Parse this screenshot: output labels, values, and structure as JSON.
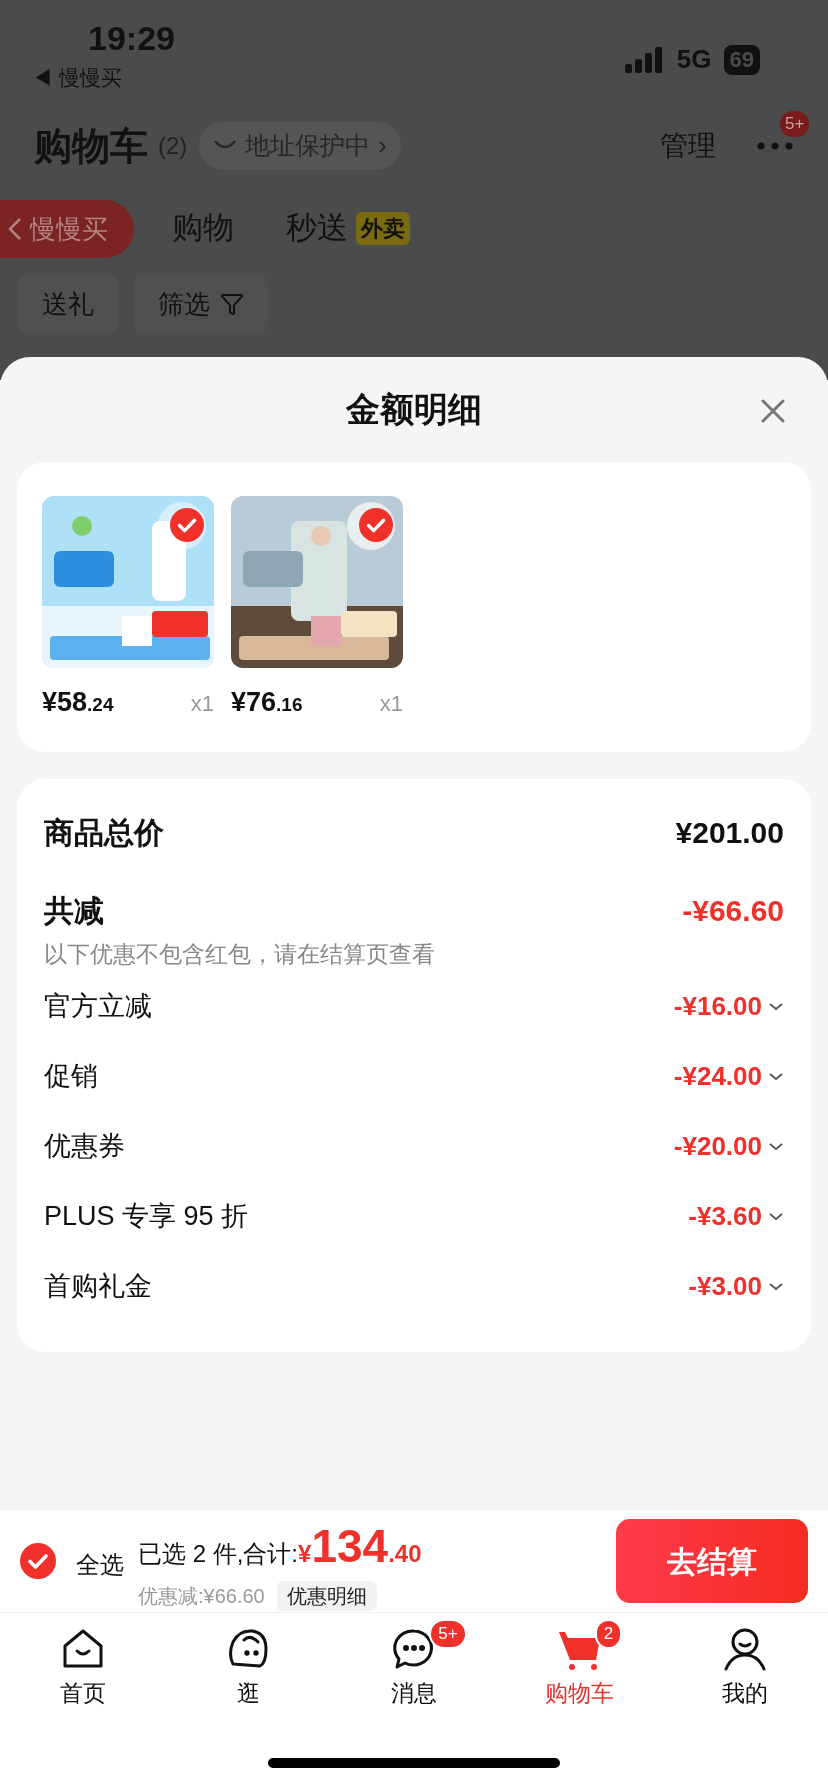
{
  "status_bar": {
    "time": "19:29",
    "back_app": "◀ 慢慢买",
    "network": "5G",
    "battery": "69"
  },
  "header": {
    "title": "购物车",
    "count": "(2)",
    "address_chip": "地址保护中",
    "chevron": "›",
    "manage": "管理",
    "more_badge": "5+"
  },
  "tabs": [
    {
      "label": "购物",
      "selected": false
    },
    {
      "label": "秒送",
      "selected": false,
      "tag": "外卖"
    }
  ],
  "floating_back": {
    "label": "慢慢买"
  },
  "chips": [
    {
      "label": "送礼",
      "kind": "plain"
    },
    {
      "label": "筛选",
      "kind": "filter"
    }
  ],
  "sheet": {
    "title": "金额明细",
    "products": [
      {
        "kind": "picture",
        "checked": true,
        "price_main": "¥58",
        "price_decimal": ".24",
        "quantity": "x1"
      },
      {
        "kind": "picture",
        "checked": true,
        "price_main": "¥76",
        "price_decimal": ".16",
        "quantity": "x1"
      }
    ],
    "total": {
      "label": "商品总价",
      "value": "¥201.00"
    },
    "reduction": {
      "label": "共减",
      "value": "-¥66.60",
      "note": "以下优惠不包含红包，请在结算页查看"
    },
    "discounts": [
      {
        "label": "官方立减",
        "value": "-¥16.00",
        "expanded": false
      },
      {
        "label": "促销",
        "value": "-¥24.00",
        "expanded": false
      },
      {
        "label": "优惠券",
        "value": "-¥20.00",
        "expanded": false
      },
      {
        "label": "PLUS 专享 95 折",
        "value": "-¥3.60",
        "expanded": false
      },
      {
        "label": "首购礼金",
        "value": "-¥3.00",
        "expanded": false
      }
    ]
  },
  "checkout": {
    "select_all": {
      "label": "全选",
      "checked": true
    },
    "summary": "已选 2 件,合计:",
    "currency": "¥",
    "amount_main": "134",
    "amount_decimal": ".40",
    "saved": "优惠减:¥66.60",
    "details_chip": "优惠明细",
    "button": "去结算"
  },
  "tab_bar": [
    {
      "kind": "home",
      "label": "首页",
      "selected": false
    },
    {
      "kind": "browse",
      "label": "逛",
      "selected": false
    },
    {
      "kind": "messages",
      "label": "消息",
      "selected": false,
      "badge": "5+"
    },
    {
      "kind": "cart",
      "label": "购物车",
      "selected": true,
      "badge": "2"
    },
    {
      "kind": "profile",
      "label": "我的",
      "selected": false
    }
  ]
}
